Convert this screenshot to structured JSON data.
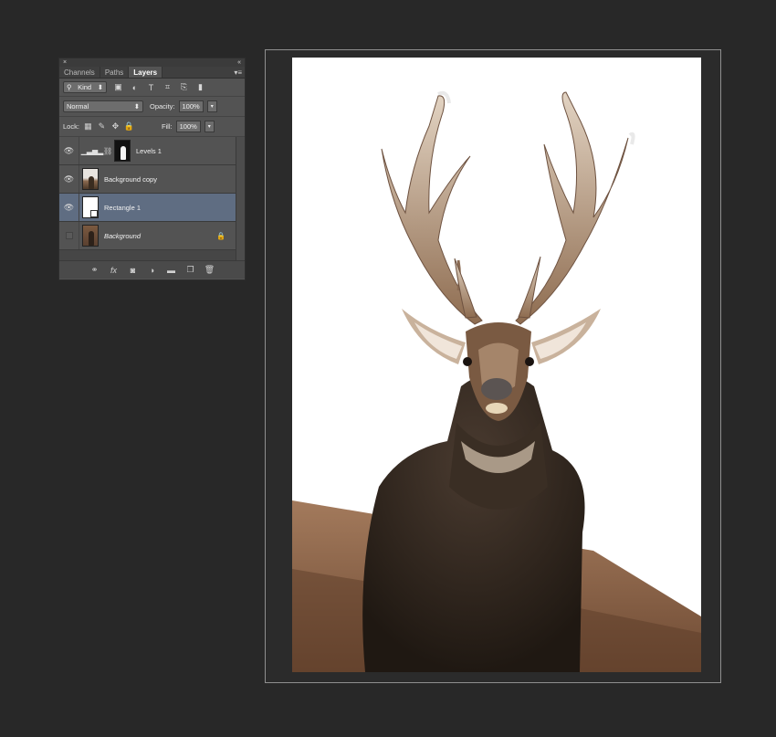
{
  "panel": {
    "top_close": "×",
    "top_collapse": "«",
    "menu_icon": "▾≡",
    "tabs": [
      {
        "label": "Channels",
        "active": false
      },
      {
        "label": "Paths",
        "active": false
      },
      {
        "label": "Layers",
        "active": true
      }
    ],
    "filter": {
      "kind_label": "Kind",
      "icons": [
        "image-filter-icon",
        "adjustment-filter-icon",
        "type-filter-icon",
        "shape-filter-icon",
        "smartobject-filter-icon",
        "filter-toggle-icon"
      ]
    },
    "blend": {
      "mode": "Normal",
      "opacity_label": "Opacity:",
      "opacity_value": "100%"
    },
    "lock": {
      "label": "Lock:",
      "icons": [
        "lock-transparent-icon",
        "lock-paint-icon",
        "lock-move-icon",
        "lock-all-icon"
      ],
      "fill_label": "Fill:",
      "fill_value": "100%"
    },
    "layers": [
      {
        "name": "Levels 1",
        "type": "adjustment",
        "visible": true,
        "selected": false
      },
      {
        "name": "Background copy",
        "type": "image",
        "visible": true,
        "selected": false
      },
      {
        "name": "Rectangle 1",
        "type": "shape",
        "visible": true,
        "selected": true
      },
      {
        "name": "Background",
        "type": "background",
        "visible": false,
        "selected": false,
        "locked": true
      }
    ],
    "bottom_icons": [
      "link-layers-icon",
      "fx-icon",
      "add-mask-icon",
      "new-adjustment-icon",
      "new-group-icon",
      "new-layer-icon",
      "delete-layer-icon"
    ]
  },
  "colors": {
    "workspace": "#282828",
    "panel": "#535353",
    "selected_layer": "#5f6d82"
  }
}
